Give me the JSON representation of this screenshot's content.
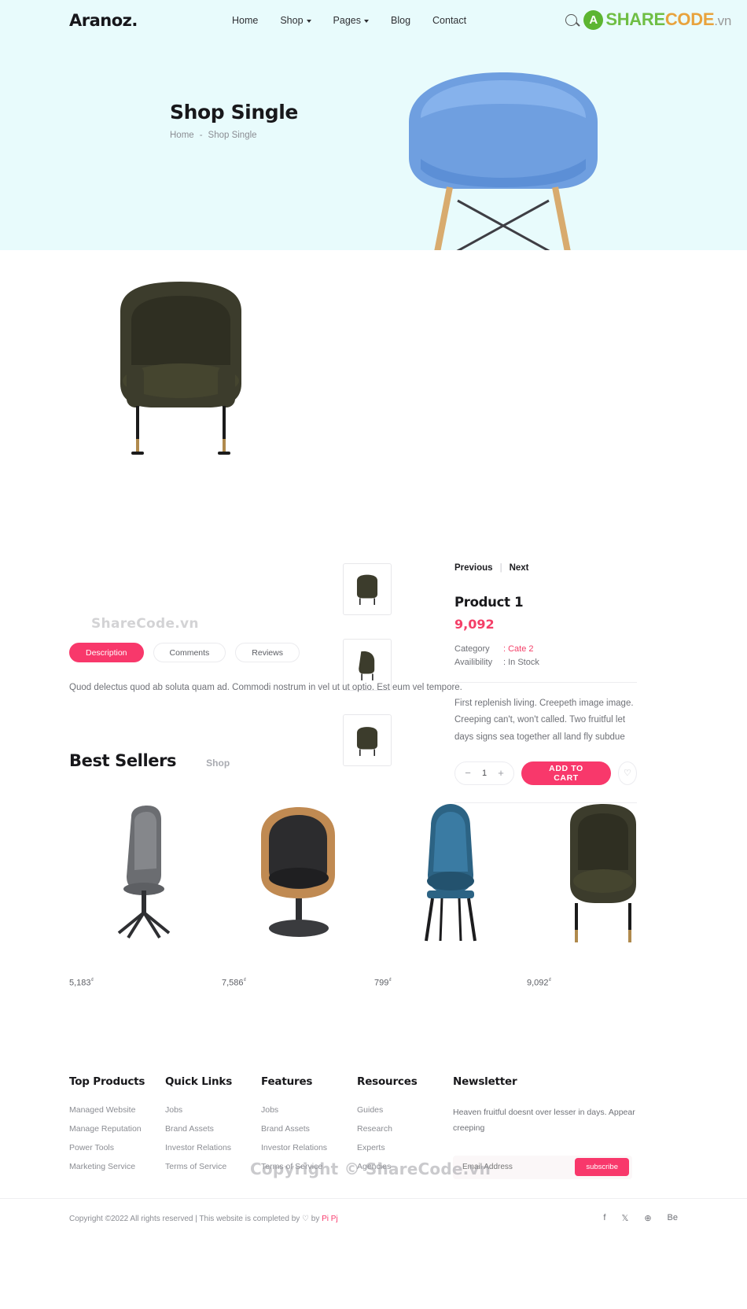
{
  "header": {
    "brand": "Aranoz.",
    "nav": [
      {
        "label": "Home",
        "caret": false
      },
      {
        "label": "Shop",
        "caret": true
      },
      {
        "label": "Pages",
        "caret": true
      },
      {
        "label": "Blog",
        "caret": false
      },
      {
        "label": "Contact",
        "caret": false
      }
    ],
    "search_icon": "search-icon",
    "watermark_logo": {
      "mark": "A",
      "share": "SHARE",
      "code": "CODE",
      "tld": ".vn"
    }
  },
  "hero": {
    "title": "Shop Single",
    "breadcrumb": {
      "home": "Home",
      "sep": "-",
      "current": "Shop Single"
    }
  },
  "product": {
    "prev": "Previous",
    "sep": "|",
    "next": "Next",
    "title": "Product 1",
    "price": "9,092",
    "category_label": "Category",
    "category_value": ": Cate 2",
    "availability_label": "Availibility",
    "availability_value": ": In Stock",
    "description": "First replenish living. Creepeth image image. Creeping can't, won't called. Two fruitful let days signs sea together all land fly subdue",
    "qty": "1",
    "minus": "−",
    "plus": "+",
    "add_to_cart": "ADD TO CART",
    "wishlist_icon": "heart-icon",
    "accent": "#f8386b"
  },
  "tabs": {
    "items": [
      {
        "label": "Description",
        "active": true
      },
      {
        "label": "Comments",
        "active": false
      },
      {
        "label": "Reviews",
        "active": false
      }
    ],
    "body": "Quod delectus quod ab soluta quam ad. Commodi nostrum in vel ut ut optio. Est eum vel tempore."
  },
  "best_sellers": {
    "title": "Best Sellers",
    "subtitle": "Shop",
    "products": [
      {
        "price": "5,183",
        "currency": "₫"
      },
      {
        "price": "7,586",
        "currency": "₫"
      },
      {
        "price": "799",
        "currency": "₫"
      },
      {
        "price": "9,092",
        "currency": "₫"
      }
    ]
  },
  "footer": {
    "columns": [
      {
        "heading": "Top Products",
        "links": [
          "Managed Website",
          "Manage Reputation",
          "Power Tools",
          "Marketing Service"
        ]
      },
      {
        "heading": "Quick Links",
        "links": [
          "Jobs",
          "Brand Assets",
          "Investor Relations",
          "Terms of Service"
        ]
      },
      {
        "heading": "Features",
        "links": [
          "Jobs",
          "Brand Assets",
          "Investor Relations",
          "Terms of Service"
        ]
      },
      {
        "heading": "Resources",
        "links": [
          "Guides",
          "Research",
          "Experts",
          "Agencies"
        ]
      }
    ],
    "newsletter": {
      "heading": "Newsletter",
      "text": "Heaven fruitful doesnt over lesser in days. Appear creeping",
      "placeholder": "Email Address",
      "button": "subscribe"
    },
    "copyright_pre": "Copyright ©2022 All rights reserved | This website is completed by ",
    "heart": "♡",
    "copyright_mid": " by ",
    "copyright_link": "Pi Pj",
    "socials": [
      "f",
      "𝕏",
      "⊕",
      "Be"
    ]
  },
  "watermarks": {
    "tabs_area": "ShareCode.vn",
    "footer_area": "Copyright © ShareCode.vn"
  }
}
